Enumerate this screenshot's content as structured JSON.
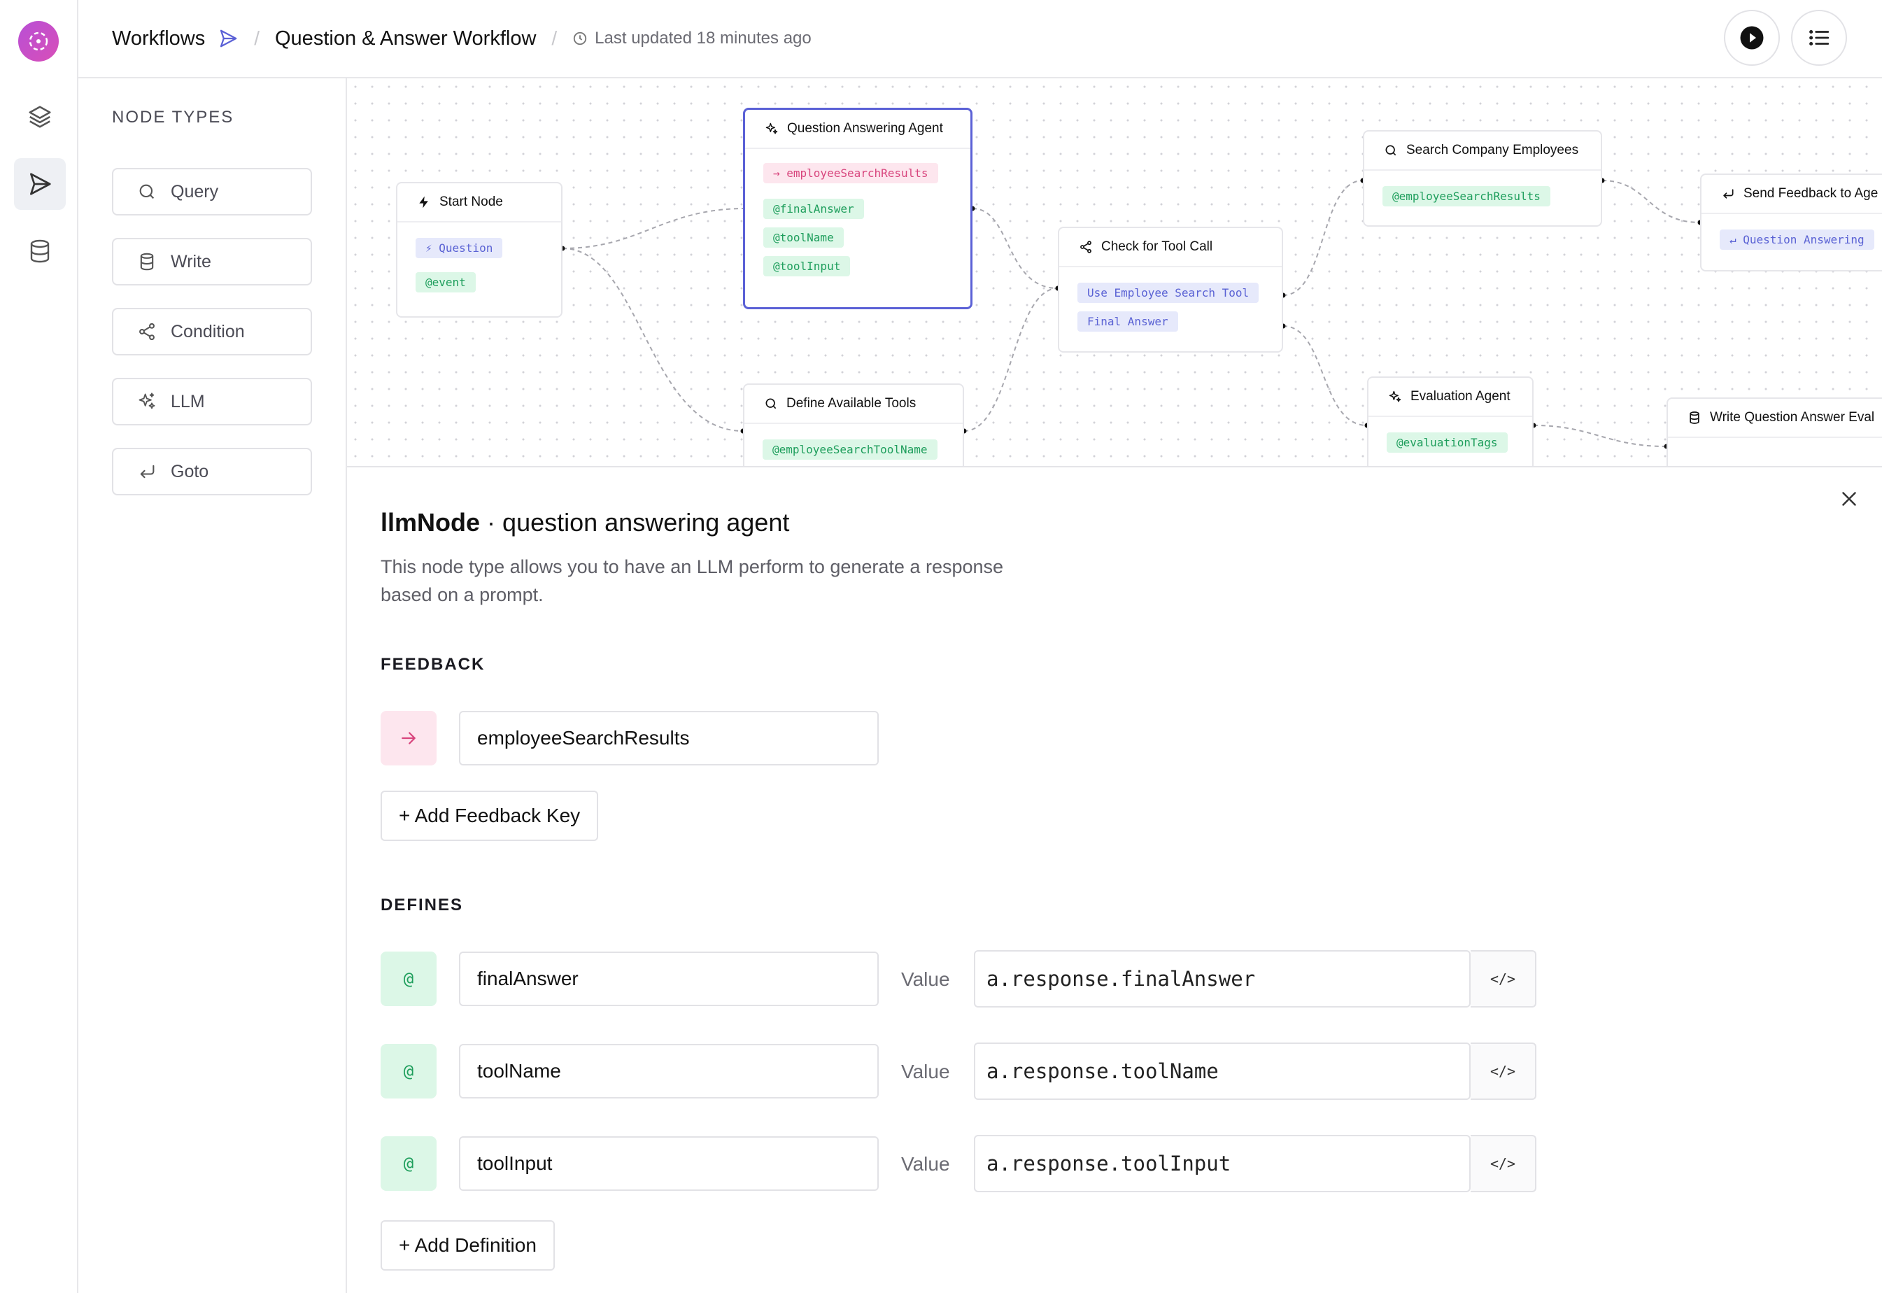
{
  "header": {
    "breadcrumb_root": "Workflows",
    "workflow_name": "Question & Answer Workflow",
    "last_updated": "Last updated 18 minutes ago"
  },
  "sidebar": {
    "title": "NODE TYPES",
    "items": [
      {
        "label": "Query",
        "icon": "search-icon"
      },
      {
        "label": "Write",
        "icon": "database-icon"
      },
      {
        "label": "Condition",
        "icon": "share-icon"
      },
      {
        "label": "LLM",
        "icon": "sparkles-icon"
      },
      {
        "label": "Goto",
        "icon": "return-icon"
      }
    ]
  },
  "canvas": {
    "nodes": {
      "start": {
        "title": "Start Node",
        "chips": [
          "Question",
          "@event"
        ]
      },
      "qa_agent": {
        "title": "Question Answering Agent",
        "chips": [
          "employeeSearchResults",
          "@finalAnswer",
          "@toolName",
          "@toolInput"
        ]
      },
      "define_tools": {
        "title": "Define Available Tools",
        "chips": [
          "@employeeSearchToolName"
        ]
      },
      "check_tool": {
        "title": "Check for Tool Call",
        "chips": [
          "Use Employee Search Tool",
          "Final Answer"
        ]
      },
      "search_employees": {
        "title": "Search Company Employees",
        "chips": [
          "@employeeSearchResults"
        ]
      },
      "evaluation": {
        "title": "Evaluation Agent",
        "chips": [
          "@evaluationTags"
        ]
      },
      "send_feedback": {
        "title": "Send Feedback to Age",
        "chips": [
          "Question Answering"
        ]
      },
      "write_eval": {
        "title": "Write Question Answer Eval",
        "chips": []
      }
    }
  },
  "detail": {
    "type": "llmNode",
    "separator": "·",
    "name": "question answering agent",
    "description": "This node type allows you to have an LLM perform to generate a response based on a prompt.",
    "feedback_title": "FEEDBACK",
    "feedback_keys": [
      "employeeSearchResults"
    ],
    "add_feedback_label": "+ Add Feedback Key",
    "defines_title": "DEFINES",
    "value_label": "Value",
    "definitions": [
      {
        "key": "finalAnswer",
        "value": "a.response.finalAnswer"
      },
      {
        "key": "toolName",
        "value": "a.response.toolName"
      },
      {
        "key": "toolInput",
        "value": "a.response.toolInput"
      }
    ],
    "add_definition_label": "+ Add Definition",
    "at_symbol": "@",
    "code_symbol": "</>"
  },
  "colors": {
    "accent": "#5b61d6",
    "green_chip": "#dcf7e7",
    "blue_chip": "#e6e9fb",
    "pink_chip": "#fde6ee"
  }
}
